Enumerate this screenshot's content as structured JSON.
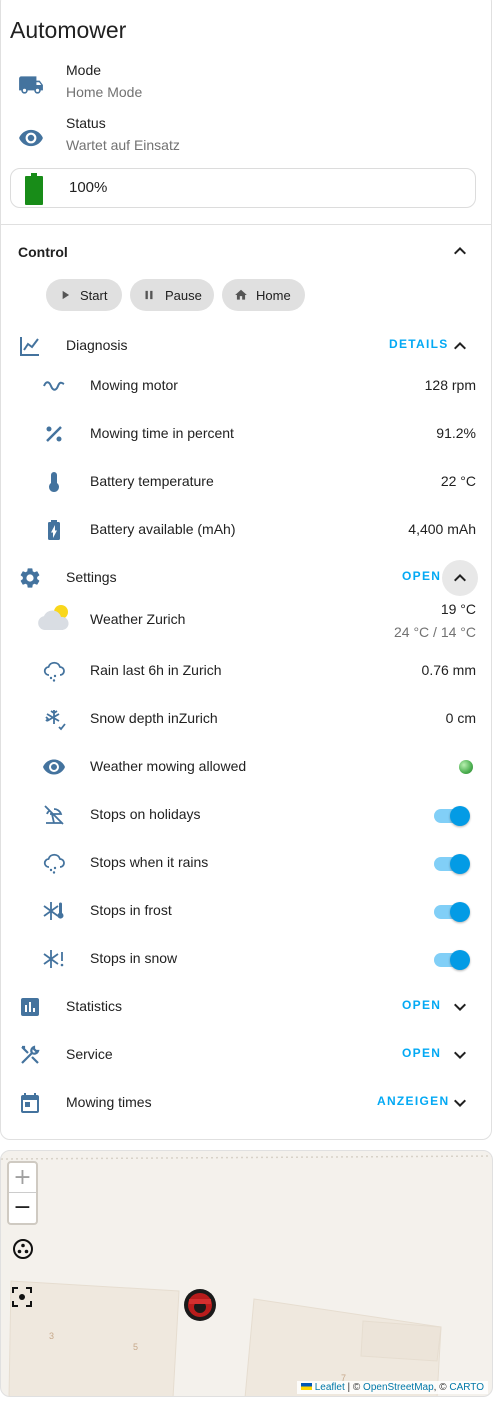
{
  "card": {
    "title": "Automower",
    "mode": {
      "label": "Mode",
      "value": "Home Mode",
      "icon": "truck-icon"
    },
    "status": {
      "label": "Status",
      "value": "Wartet auf Einsatz",
      "icon": "eye-icon"
    },
    "battery": {
      "value": "100%",
      "level": 1.0,
      "color": "#188c18"
    }
  },
  "control": {
    "title": "Control",
    "buttons": [
      {
        "label": "Start",
        "icon": "play-icon"
      },
      {
        "label": "Pause",
        "icon": "pause-icon"
      },
      {
        "label": "Home",
        "icon": "home-icon"
      }
    ]
  },
  "diagnosis": {
    "label": "Diagnosis",
    "action": "DETAILS",
    "items": [
      {
        "label": "Mowing motor",
        "value": "128 rpm",
        "icon": "sine-wave-icon"
      },
      {
        "label": "Mowing time in percent",
        "value": "91.2%",
        "icon": "percent-icon"
      },
      {
        "label": "Battery temperature",
        "value": "22 °C",
        "icon": "thermometer-icon"
      },
      {
        "label": "Battery available (mAh)",
        "value": "4,400 mAh",
        "icon": "battery-charging-icon"
      }
    ]
  },
  "settings": {
    "label": "Settings",
    "action": "OPEN",
    "weather": {
      "label": "Weather Zurich",
      "temp": "19 °C",
      "range": "24 °C / 14 °C",
      "icon": "partly-cloudy-icon"
    },
    "items": [
      {
        "label": "Rain last 6h in Zurich",
        "value": "0.76 mm",
        "icon": "cloud-rain-icon"
      },
      {
        "label": "Snow depth inZurich",
        "value": "0 cm",
        "icon": "snowflake-check-icon"
      }
    ],
    "weather_allowed": {
      "label": "Weather mowing allowed",
      "state": "on",
      "icon": "eye-icon"
    },
    "toggles": [
      {
        "label": "Stops on holidays",
        "state": "on",
        "icon": "beach-off-icon"
      },
      {
        "label": "Stops when it rains",
        "state": "on",
        "icon": "cloud-rain-icon"
      },
      {
        "label": "Stops in frost",
        "state": "on",
        "icon": "snowflake-thermometer-icon"
      },
      {
        "label": "Stops in snow",
        "state": "on",
        "icon": "snowflake-alert-icon"
      }
    ]
  },
  "statistics": {
    "label": "Statistics",
    "action": "OPEN",
    "icon": "bar-chart-icon"
  },
  "service": {
    "label": "Service",
    "action": "OPEN",
    "icon": "tools-icon"
  },
  "mowing_times": {
    "label": "Mowing times",
    "action": "ANZEIGEN",
    "icon": "calendar-icon"
  },
  "map": {
    "zoom_in": "+",
    "zoom_out": "−",
    "house_numbers": [
      "3",
      "5",
      "7"
    ],
    "attribution": {
      "leaflet": "Leaflet",
      "sep1": " | © ",
      "osm": "OpenStreetMap",
      "sep2": ", © ",
      "carto": "CARTO"
    }
  },
  "colors": {
    "accent": "#03a9f4",
    "icon": "#44739e",
    "toggle": "#039be5"
  }
}
